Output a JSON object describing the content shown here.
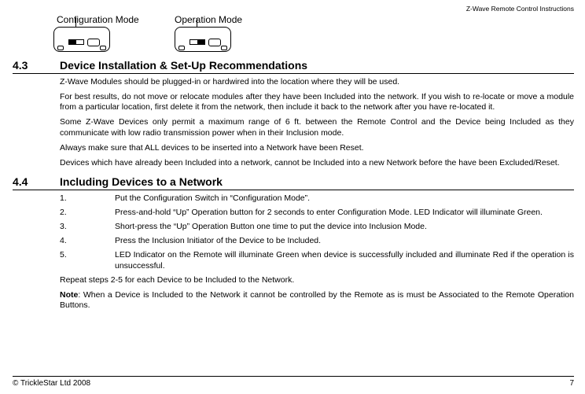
{
  "header_right": "Z-Wave Remote Control Instructions",
  "mode_labels": {
    "config": "Configuration Mode",
    "operation": "Operation Mode"
  },
  "section_4_3": {
    "num": "4.3",
    "title": "Device Installation & Set-Up Recommendations",
    "paras": [
      "Z-Wave Modules should be plugged-in or hardwired into the location where they will be used.",
      "For best results, do not move or relocate modules after they have been Included into the network. If you wish to re-locate or move a module from a particular location, first delete it from the network, then include it back to the network after you have re-located it.",
      "Some Z-Wave Devices only permit a maximum range of 6 ft. between the Remote Control and the Device being Included as they communicate with low radio transmission power when in their Inclusion mode.",
      "Always make sure that ALL devices to be inserted into a Network have been Reset.",
      "Devices which have already been Included into a network, cannot be Included into a new Network before the have been Excluded/Reset."
    ]
  },
  "section_4_4": {
    "num": "4.4",
    "title": "Including Devices to a Network",
    "items": [
      "Put the Configuration Switch in “Configuration Mode”.",
      "Press-and-hold “Up” Operation button for 2 seconds to enter Configuration Mode. LED Indicator will illuminate Green.",
      "Short-press the “Up” Operation Button one time to put the device into Inclusion Mode.",
      "Press the Inclusion Initiator of the Device to be Included.",
      "LED Indicator on the Remote will illuminate Green when device is successfully included and illuminate Red if the operation is unsuccessful."
    ],
    "repeat": "Repeat steps 2-5 for each Device to be Included to the Network.",
    "note_label": "Note",
    "note_body": ": When a Device is Included to the Network it cannot be controlled by the Remote as is must be Associated to the Remote Operation Buttons."
  },
  "footer": {
    "left": "© TrickleStar Ltd 2008",
    "right": "7"
  },
  "list_nums": [
    "1.",
    "2.",
    "3.",
    "4.",
    "5."
  ]
}
